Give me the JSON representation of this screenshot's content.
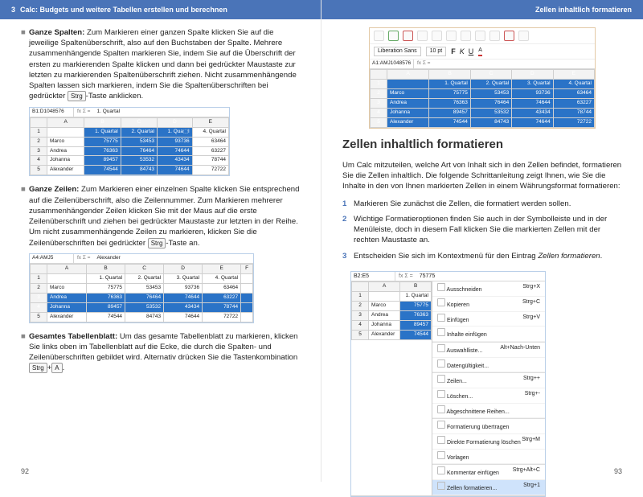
{
  "header": {
    "chapter_num": "3",
    "chapter_title": "Calc: Budgets und weitere Tabellen erstellen und berechnen",
    "section_title": "Zellen inhaltlich formatieren"
  },
  "left": {
    "p1_bold": "Ganze Spalten:",
    "p1": " Zum Markieren einer ganzen Spalte klicken Sie auf die jeweilige Spaltenüberschrift, also auf den Buchstaben der Spalte. Mehrere zusammenhängende Spalten markieren Sie, indem Sie auf die Überschrift der ersten zu markierenden Spalte klicken und dann bei gedrückter Maustaste zur letzten zu markierenden Spaltenüberschrift ziehen. Nicht zusammenhängende Spalten lassen sich markieren, indem Sie die Spaltenüberschriften bei gedrückter ",
    "p1_key": "Strg",
    "p1_end": "-Taste anklicken.",
    "fig1": {
      "cellref": "B1:D1048576",
      "fx": "fx  Σ  =",
      "val": "1. Quartal",
      "cols": [
        "",
        "A",
        "B",
        "C",
        "D",
        "E"
      ],
      "rows": [
        [
          "1",
          "",
          "1. Quartal",
          "2. Quartal",
          "1. Qua⬚l",
          "4. Quartal"
        ],
        [
          "2",
          "Marco",
          "75775",
          "53453",
          "93736",
          "63464"
        ],
        [
          "3",
          "Andrea",
          "76363",
          "76464",
          "74644",
          "63227"
        ],
        [
          "4",
          "Johanna",
          "89457",
          "53532",
          "43434",
          "78744"
        ],
        [
          "5",
          "Alexander",
          "74544",
          "84743",
          "74644",
          "72722"
        ]
      ]
    },
    "p2_bold": "Ganze Zeilen:",
    "p2": " Zum Markieren einer einzelnen Spalte klicken Sie entsprechend auf die Zeilenüberschrift, also die Zeilennummer. Zum Markieren mehrerer zusammenhängender Zeilen klicken Sie mit der Maus auf die erste Zeilenüberschrift und ziehen bei gedrückter Maustaste zur letzten in der Reihe. Um nicht zusammenhängende Zeilen zu markieren, klicken Sie die Zeilenüberschriften bei gedrückter ",
    "p2_key": "Strg",
    "p2_end": "-Taste an.",
    "fig2": {
      "cellref": "A4:AMJ5",
      "fx": "fx  Σ  =",
      "val": "Alexander",
      "cols": [
        "",
        "A",
        "B",
        "C",
        "D",
        "E",
        "F"
      ],
      "rows": [
        [
          "1",
          "",
          "1. Quartal",
          "2. Quartal",
          "3. Quartal",
          "4. Quartal",
          ""
        ],
        [
          "2",
          "Marco",
          "75775",
          "53453",
          "93736",
          "63464",
          ""
        ],
        [
          "3",
          "Andrea",
          "76363",
          "76464",
          "74644",
          "63227",
          ""
        ],
        [
          "4",
          "Johanna",
          "89457",
          "53532",
          "43434",
          "78744",
          ""
        ],
        [
          "5",
          "Alexander",
          "74544",
          "84743",
          "74644",
          "72722",
          ""
        ]
      ]
    },
    "p3_bold": "Gesamtes Tabellenblatt:",
    "p3": " Um das gesamte Tabellenblatt zu markieren, klicken Sie links oben im Tabellenblatt auf die Ecke, die durch die Spalten- und Zeilenüberschriften gebildet wird. Alternativ drücken Sie die Tastenkombination ",
    "p3_key1": "Strg",
    "p3_plus": "+",
    "p3_key2": "A",
    "p3_end": ".",
    "pageno": "92"
  },
  "right": {
    "toolbar_font": "Liberation Sans",
    "toolbar_size": "10 pt",
    "toolbar_cellref": "A1:AMJ1048576",
    "fig_cols": [
      "",
      "A",
      "B",
      "C",
      "D",
      "E"
    ],
    "fig_rows": [
      [
        "1",
        "",
        "1. Quartal",
        "2. Quartal",
        "3. Quartal",
        "4. Quartal"
      ],
      [
        "2",
        "Marco",
        "75775",
        "53453",
        "93736",
        "63464"
      ],
      [
        "3",
        "Andrea",
        "76363",
        "76464",
        "74644",
        "63227"
      ],
      [
        "4",
        "Johanna",
        "89457",
        "53532",
        "43434",
        "78744"
      ],
      [
        "5",
        "Alexander",
        "74544",
        "84743",
        "74644",
        "72722"
      ]
    ],
    "h2": "Zellen inhaltlich formatieren",
    "intro": "Um Calc mitzuteilen, welche Art von Inhalt sich in den Zellen befindet, formatieren Sie die Zellen inhaltlich. Die folgende Schrittanleitung zeigt Ihnen, wie Sie die Inhalte in den von Ihnen markierten Zellen in einem Währungsformat formatieren:",
    "s1": "Markieren Sie zunächst die Zellen, die formatiert werden sollen.",
    "s2": "Wichtige Formatieroptionen finden Sie auch in der Symbolleiste und in der Menüleiste, doch in diesem Fall klicken Sie die markierten Zellen mit der rechten Maustaste an.",
    "s3a": "Entscheiden Sie sich im Kontextmenü für den Eintrag ",
    "s3b": "Zellen formatieren",
    "s3c": ".",
    "ctx": {
      "cellref": "B2:E5",
      "val": "75775",
      "sheet_cols": [
        "",
        "A",
        "B"
      ],
      "sheet_rows": [
        [
          "1",
          "",
          "1. Quartal"
        ],
        [
          "2",
          "Marco",
          "75775"
        ],
        [
          "3",
          "Andrea",
          "76363"
        ],
        [
          "4",
          "Johanna",
          "89457"
        ],
        [
          "5",
          "Alexander",
          "74544"
        ]
      ],
      "menu": [
        [
          "Ausschneiden",
          "Strg+X"
        ],
        [
          "Kopieren",
          "Strg+C"
        ],
        [
          "Einfügen",
          "Strg+V"
        ],
        [
          "Inhalte einfügen",
          ""
        ],
        [
          "---",
          ""
        ],
        [
          "Auswahlliste...",
          "Alt+Nach-Unten"
        ],
        [
          "Datengültigkeit...",
          ""
        ],
        [
          "---",
          ""
        ],
        [
          "Zeilen...",
          "Strg++"
        ],
        [
          "Löschen...",
          "Strg+-"
        ],
        [
          "Abgeschnittene Reihen...",
          ""
        ],
        [
          "---",
          ""
        ],
        [
          "Formatierung übertragen",
          ""
        ],
        [
          "Direkte Formatierung löschen",
          "Strg+M"
        ],
        [
          "Vorlagen",
          ""
        ],
        [
          "---",
          ""
        ],
        [
          "Kommentar einfügen",
          "Strg+Alt+C"
        ],
        [
          "Zellen formatieren...",
          "Strg+1"
        ]
      ]
    },
    "pageno": "93"
  }
}
